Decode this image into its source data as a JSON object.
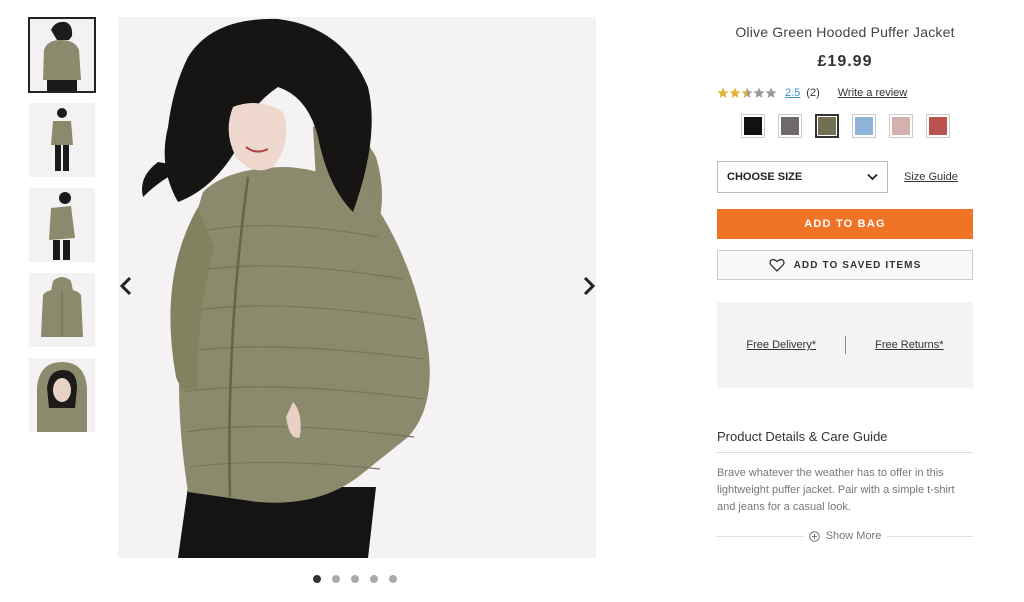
{
  "product": {
    "title": "Olive Green Hooded Puffer Jacket",
    "price": "£19.99"
  },
  "rating": {
    "value": "2.5",
    "count": "(2)",
    "stars_filled_fraction": 0.5,
    "write_review_label": "Write a review"
  },
  "swatches": [
    {
      "name": "black",
      "color": "#111111",
      "selected": false
    },
    {
      "name": "grey",
      "color": "#6e6a6c",
      "selected": false
    },
    {
      "name": "olive",
      "color": "#726f55",
      "selected": true
    },
    {
      "name": "light-blue",
      "color": "#8fb3d8",
      "selected": false
    },
    {
      "name": "pink",
      "color": "#d4b1ad",
      "selected": false
    },
    {
      "name": "red",
      "color": "#b9524f",
      "selected": false
    }
  ],
  "size": {
    "select_label": "CHOOSE SIZE",
    "guide_label": "Size Guide"
  },
  "actions": {
    "add_to_bag": "ADD TO BAG",
    "add_to_saved": "ADD TO SAVED ITEMS"
  },
  "delivery": {
    "free_delivery": "Free Delivery*",
    "free_returns": "Free Returns*"
  },
  "details": {
    "title": "Product Details & Care Guide",
    "text": "Brave whatever the weather has to offer in this lightweight puffer jacket. Pair with a simple t-shirt and jeans for a casual look.",
    "show_more": "Show More"
  },
  "gallery": {
    "thumbnail_count": 5,
    "active_index": 0
  },
  "colors": {
    "accent": "#f07326",
    "link_blue": "#3a8fd0",
    "jacket": "#8b8a6c"
  }
}
